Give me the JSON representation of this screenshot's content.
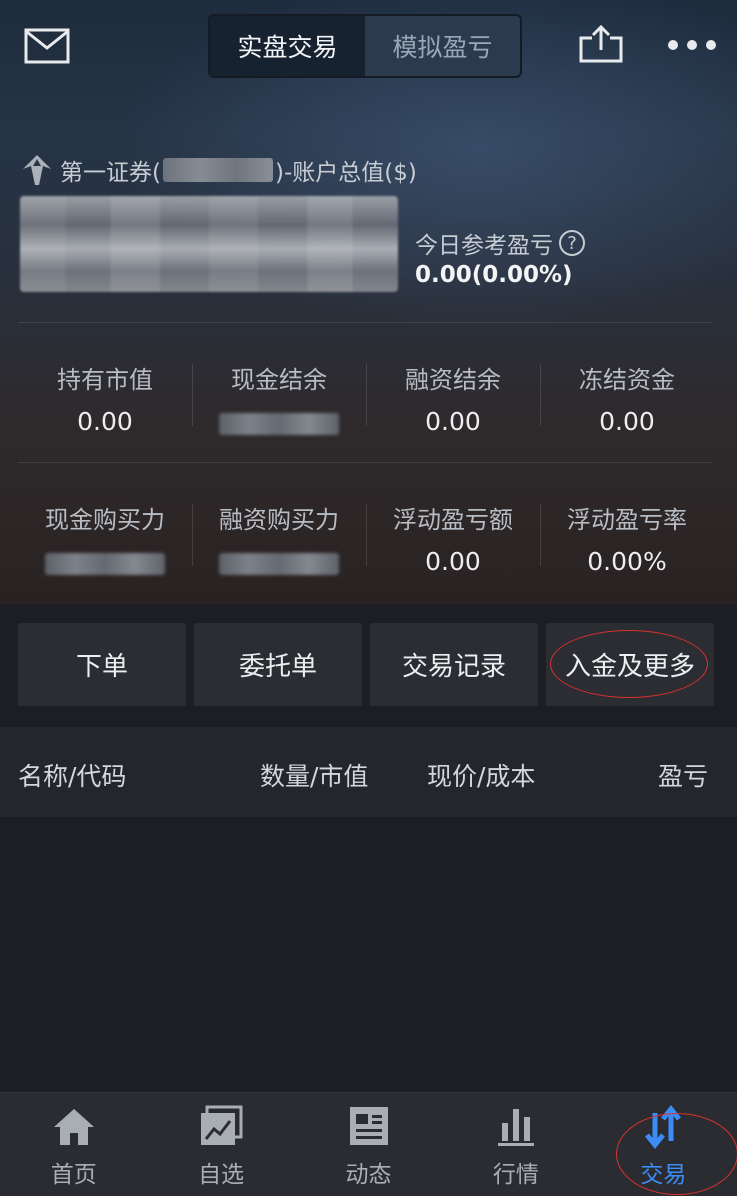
{
  "colors": {
    "accent": "#3b8cf5",
    "annotation": "#d8322d",
    "background": "#1c1e23"
  },
  "header": {
    "tabs": [
      {
        "label": "实盘交易",
        "active": true
      },
      {
        "label": "模拟盈亏",
        "active": false
      }
    ],
    "icons": [
      "mail-icon",
      "share-icon",
      "more-icon"
    ]
  },
  "account": {
    "broker_prefix": "第一证券(",
    "title_suffix": ")-账户总值($)",
    "today_label": "今日参考盈亏",
    "today_value": "0.00(0.00%)"
  },
  "stats_row1": [
    {
      "label": "持有市值",
      "value": "0.00"
    },
    {
      "label": "现金结余",
      "value": null
    },
    {
      "label": "融资结余",
      "value": "0.00"
    },
    {
      "label": "冻结资金",
      "value": "0.00"
    }
  ],
  "stats_row2": [
    {
      "label": "现金购买力",
      "value": null
    },
    {
      "label": "融资购买力",
      "value": null
    },
    {
      "label": "浮动盈亏额",
      "value": "0.00"
    },
    {
      "label": "浮动盈亏率",
      "value": "0.00%"
    }
  ],
  "actions": [
    "下单",
    "委托单",
    "交易记录",
    "入金及更多"
  ],
  "holdings": {
    "columns": [
      "名称/代码",
      "数量/市值",
      "现价/成本",
      "盈亏"
    ]
  },
  "nav": [
    {
      "label": "首页",
      "icon": "home-icon"
    },
    {
      "label": "自选",
      "icon": "watchlist-icon"
    },
    {
      "label": "动态",
      "icon": "news-icon"
    },
    {
      "label": "行情",
      "icon": "market-icon"
    },
    {
      "label": "交易",
      "icon": "trade-icon",
      "active": true
    }
  ]
}
